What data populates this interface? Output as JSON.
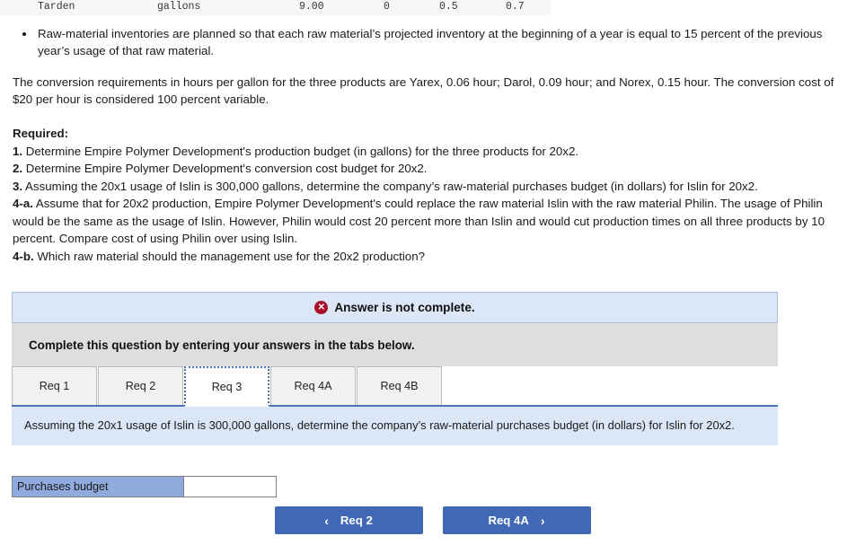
{
  "table_strip": {
    "name": "Tarden",
    "unit": "gallons",
    "v1": "9.00",
    "v2": "0",
    "v3": "0.5",
    "v4": "0.7"
  },
  "bullets": [
    "Raw-material inventories are planned so that each raw material’s projected inventory at the beginning of a year is equal to 15 percent of the previous year’s usage of that raw material."
  ],
  "paragraph": "The conversion requirements in hours per gallon for the three products are Yarex, 0.06 hour; Darol, 0.09 hour; and Norex, 0.15 hour. The conversion cost of $20 per hour is considered 100 percent variable.",
  "required": {
    "title": "Required:",
    "items": [
      {
        "num": "1.",
        "text": " Determine Empire Polymer Development's production budget (in gallons) for the three products for 20x2."
      },
      {
        "num": "2.",
        "text": " Determine Empire Polymer Development's conversion cost budget for 20x2."
      },
      {
        "num": "3.",
        "text": " Assuming the 20x1 usage of Islin is 300,000 gallons, determine the company’s raw-material purchases budget (in dollars) for Islin for 20x2."
      },
      {
        "num": "4-a.",
        "text": " Assume that for 20x2 production, Empire Polymer Development's could replace the raw material Islin with the raw material Philin. The usage of Philin would be the same as the usage of Islin. However, Philin would cost 20 percent more than Islin and would cut production times on all three products by 10 percent. Compare cost of using Philin over using Islin."
      },
      {
        "num": "4-b.",
        "text": " Which raw material should the management use for the 20x2 production?"
      }
    ]
  },
  "alert": {
    "icon": "error-x-icon",
    "text": "Answer is not complete.",
    "bg_color": "#dbe7f6",
    "icon_color": "#a90f2b"
  },
  "instruction": "Complete this question by entering your answers in the tabs below.",
  "tabs": [
    {
      "label": "Req 1",
      "active": false
    },
    {
      "label": "Req 2",
      "active": false
    },
    {
      "label": "Req 3",
      "active": true
    },
    {
      "label": "Req 4A",
      "active": false
    },
    {
      "label": "Req 4B",
      "active": false
    }
  ],
  "question_panel": {
    "text": "Assuming the 20x1 usage of Islin is 300,000 gallons, determine the company’s raw-material purchases budget (in dollars) for Islin for 20x2.",
    "bg_color": "#dbe7f6"
  },
  "answer_grid": {
    "row_label": "Purchases budget",
    "value": "",
    "placeholder": "",
    "label_bg_color": "#8faadc"
  },
  "nav": {
    "prev_label": "Req 2",
    "prev_icon": "chevron-left-icon",
    "next_label": "Req 4A",
    "next_icon": "chevron-right-icon",
    "button_color": "#4068b4"
  }
}
